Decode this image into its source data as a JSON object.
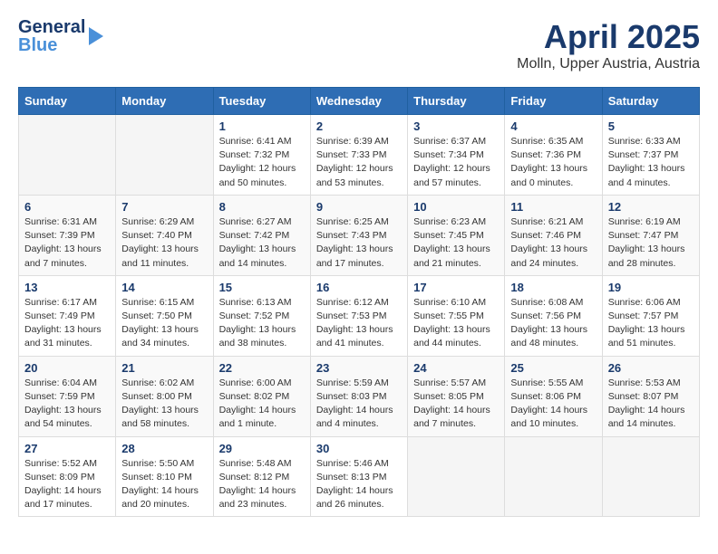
{
  "header": {
    "logo_general": "General",
    "logo_blue": "Blue",
    "month_title": "April 2025",
    "location": "Molln, Upper Austria, Austria"
  },
  "days_of_week": [
    "Sunday",
    "Monday",
    "Tuesday",
    "Wednesday",
    "Thursday",
    "Friday",
    "Saturday"
  ],
  "weeks": [
    [
      {
        "num": "",
        "info": ""
      },
      {
        "num": "",
        "info": ""
      },
      {
        "num": "1",
        "info": "Sunrise: 6:41 AM\nSunset: 7:32 PM\nDaylight: 12 hours\nand 50 minutes."
      },
      {
        "num": "2",
        "info": "Sunrise: 6:39 AM\nSunset: 7:33 PM\nDaylight: 12 hours\nand 53 minutes."
      },
      {
        "num": "3",
        "info": "Sunrise: 6:37 AM\nSunset: 7:34 PM\nDaylight: 12 hours\nand 57 minutes."
      },
      {
        "num": "4",
        "info": "Sunrise: 6:35 AM\nSunset: 7:36 PM\nDaylight: 13 hours\nand 0 minutes."
      },
      {
        "num": "5",
        "info": "Sunrise: 6:33 AM\nSunset: 7:37 PM\nDaylight: 13 hours\nand 4 minutes."
      }
    ],
    [
      {
        "num": "6",
        "info": "Sunrise: 6:31 AM\nSunset: 7:39 PM\nDaylight: 13 hours\nand 7 minutes."
      },
      {
        "num": "7",
        "info": "Sunrise: 6:29 AM\nSunset: 7:40 PM\nDaylight: 13 hours\nand 11 minutes."
      },
      {
        "num": "8",
        "info": "Sunrise: 6:27 AM\nSunset: 7:42 PM\nDaylight: 13 hours\nand 14 minutes."
      },
      {
        "num": "9",
        "info": "Sunrise: 6:25 AM\nSunset: 7:43 PM\nDaylight: 13 hours\nand 17 minutes."
      },
      {
        "num": "10",
        "info": "Sunrise: 6:23 AM\nSunset: 7:45 PM\nDaylight: 13 hours\nand 21 minutes."
      },
      {
        "num": "11",
        "info": "Sunrise: 6:21 AM\nSunset: 7:46 PM\nDaylight: 13 hours\nand 24 minutes."
      },
      {
        "num": "12",
        "info": "Sunrise: 6:19 AM\nSunset: 7:47 PM\nDaylight: 13 hours\nand 28 minutes."
      }
    ],
    [
      {
        "num": "13",
        "info": "Sunrise: 6:17 AM\nSunset: 7:49 PM\nDaylight: 13 hours\nand 31 minutes."
      },
      {
        "num": "14",
        "info": "Sunrise: 6:15 AM\nSunset: 7:50 PM\nDaylight: 13 hours\nand 34 minutes."
      },
      {
        "num": "15",
        "info": "Sunrise: 6:13 AM\nSunset: 7:52 PM\nDaylight: 13 hours\nand 38 minutes."
      },
      {
        "num": "16",
        "info": "Sunrise: 6:12 AM\nSunset: 7:53 PM\nDaylight: 13 hours\nand 41 minutes."
      },
      {
        "num": "17",
        "info": "Sunrise: 6:10 AM\nSunset: 7:55 PM\nDaylight: 13 hours\nand 44 minutes."
      },
      {
        "num": "18",
        "info": "Sunrise: 6:08 AM\nSunset: 7:56 PM\nDaylight: 13 hours\nand 48 minutes."
      },
      {
        "num": "19",
        "info": "Sunrise: 6:06 AM\nSunset: 7:57 PM\nDaylight: 13 hours\nand 51 minutes."
      }
    ],
    [
      {
        "num": "20",
        "info": "Sunrise: 6:04 AM\nSunset: 7:59 PM\nDaylight: 13 hours\nand 54 minutes."
      },
      {
        "num": "21",
        "info": "Sunrise: 6:02 AM\nSunset: 8:00 PM\nDaylight: 13 hours\nand 58 minutes."
      },
      {
        "num": "22",
        "info": "Sunrise: 6:00 AM\nSunset: 8:02 PM\nDaylight: 14 hours\nand 1 minute."
      },
      {
        "num": "23",
        "info": "Sunrise: 5:59 AM\nSunset: 8:03 PM\nDaylight: 14 hours\nand 4 minutes."
      },
      {
        "num": "24",
        "info": "Sunrise: 5:57 AM\nSunset: 8:05 PM\nDaylight: 14 hours\nand 7 minutes."
      },
      {
        "num": "25",
        "info": "Sunrise: 5:55 AM\nSunset: 8:06 PM\nDaylight: 14 hours\nand 10 minutes."
      },
      {
        "num": "26",
        "info": "Sunrise: 5:53 AM\nSunset: 8:07 PM\nDaylight: 14 hours\nand 14 minutes."
      }
    ],
    [
      {
        "num": "27",
        "info": "Sunrise: 5:52 AM\nSunset: 8:09 PM\nDaylight: 14 hours\nand 17 minutes."
      },
      {
        "num": "28",
        "info": "Sunrise: 5:50 AM\nSunset: 8:10 PM\nDaylight: 14 hours\nand 20 minutes."
      },
      {
        "num": "29",
        "info": "Sunrise: 5:48 AM\nSunset: 8:12 PM\nDaylight: 14 hours\nand 23 minutes."
      },
      {
        "num": "30",
        "info": "Sunrise: 5:46 AM\nSunset: 8:13 PM\nDaylight: 14 hours\nand 26 minutes."
      },
      {
        "num": "",
        "info": ""
      },
      {
        "num": "",
        "info": ""
      },
      {
        "num": "",
        "info": ""
      }
    ]
  ]
}
